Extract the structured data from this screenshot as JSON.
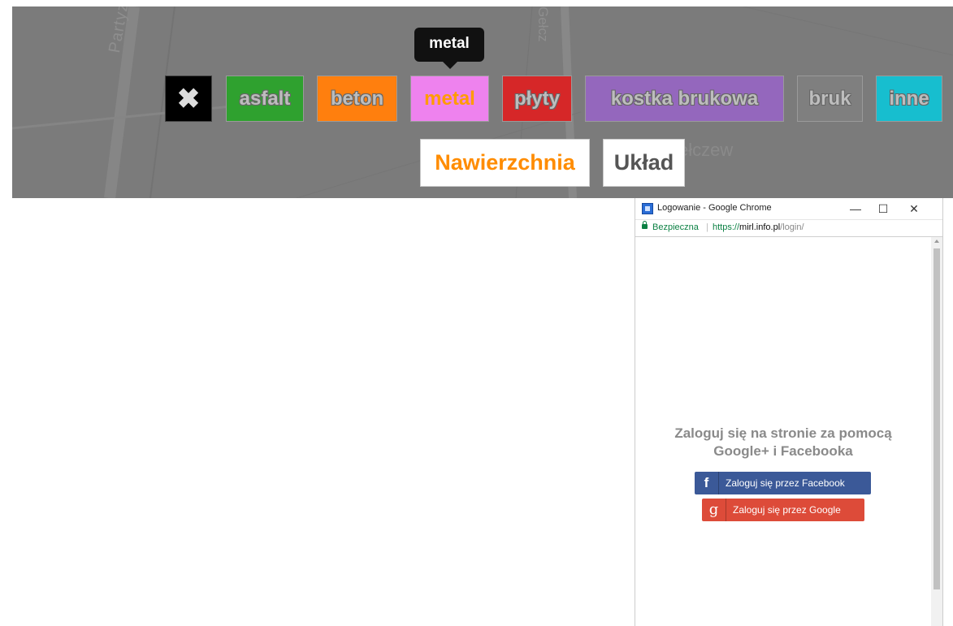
{
  "map": {
    "street_label": "Partyzantów",
    "street_label2": "Gełcz",
    "place_label": "ełczew",
    "tooltip": "metal",
    "clear_symbol": "✖",
    "filters": [
      {
        "label": "asfalt",
        "color": "#2fa12f"
      },
      {
        "label": "beton",
        "color": "#ff7f0e"
      },
      {
        "label": "metal",
        "color": "#ee82ee"
      },
      {
        "label": "płyty",
        "color": "#d62728"
      },
      {
        "label": "kostka brukowa",
        "color": "#9467bd"
      },
      {
        "label": "bruk",
        "color": "#7f7f7f"
      },
      {
        "label": "inne",
        "color": "#17becf"
      }
    ],
    "tabs": [
      "Nawierzchnia",
      "Układ"
    ]
  },
  "popup": {
    "title": "Logowanie - Google Chrome",
    "controls": {
      "minimize": "—",
      "maximize": "☐",
      "close": "✕"
    },
    "secure_label": "Bezpieczna",
    "separator": "|",
    "url_scheme": "https://",
    "url_host": "mirl.info.pl",
    "url_path": "/login/",
    "login_title": "Zaloguj się na stronie za pomocą Google+ i Facebooka",
    "facebook_icon": "f",
    "facebook_button": "Zaloguj się przez Facebook",
    "google_icon": "g",
    "google_button": "Zaloguj się przez Google"
  }
}
